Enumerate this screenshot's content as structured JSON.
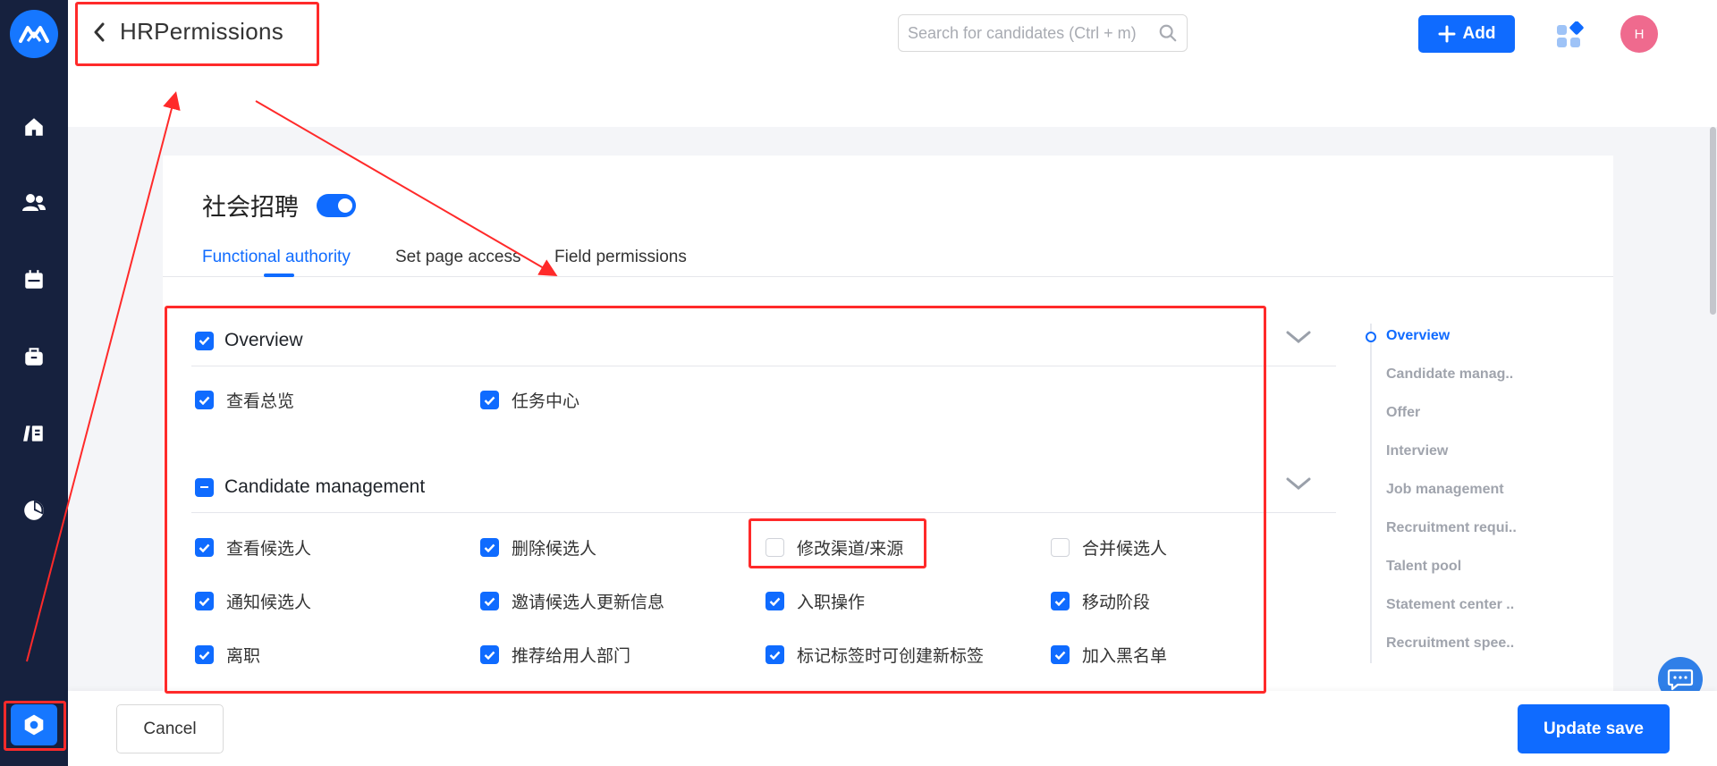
{
  "page": {
    "title": "HRPermissions",
    "back_icon": "chevron-left-icon"
  },
  "topbar": {
    "search_placeholder": "Search for candidates (Ctrl + m)",
    "add_label": "Add",
    "avatar_initial": "H"
  },
  "sidebar": {
    "items": [
      "home-icon",
      "users-icon",
      "calendar-icon",
      "briefcase-icon",
      "book-icon",
      "pie-chart-icon",
      "settings-icon"
    ],
    "active": "settings-icon"
  },
  "recruitment": {
    "title": "社会招聘",
    "enabled": true
  },
  "tabs": [
    {
      "label": "Functional authority",
      "active": true
    },
    {
      "label": "Set page access",
      "active": false
    },
    {
      "label": "Field permissions",
      "active": false
    }
  ],
  "sections": {
    "overview": {
      "title": "Overview",
      "state": "checked",
      "items": [
        {
          "label": "查看总览",
          "checked": true
        },
        {
          "label": "任务中心",
          "checked": true
        }
      ]
    },
    "candidate_management": {
      "title": "Candidate management",
      "state": "indeterminate",
      "items": [
        {
          "label": "查看候选人",
          "checked": true
        },
        {
          "label": "删除候选人",
          "checked": true
        },
        {
          "label": "修改渠道/来源",
          "checked": false
        },
        {
          "label": "合并候选人",
          "checked": false
        },
        {
          "label": "通知候选人",
          "checked": true
        },
        {
          "label": "邀请候选人更新信息",
          "checked": true
        },
        {
          "label": "入职操作",
          "checked": true
        },
        {
          "label": "移动阶段",
          "checked": true
        },
        {
          "label": "离职",
          "checked": true
        },
        {
          "label": "推荐给用人部门",
          "checked": true
        },
        {
          "label": "标记标签时可创建新标签",
          "checked": true
        },
        {
          "label": "加入黑名单",
          "checked": true
        }
      ]
    }
  },
  "right_nav": [
    {
      "label": "Overview",
      "active": true
    },
    {
      "label": "Candidate manag..",
      "active": false
    },
    {
      "label": "Offer",
      "active": false
    },
    {
      "label": "Interview",
      "active": false
    },
    {
      "label": "Job management",
      "active": false
    },
    {
      "label": "Recruitment requi..",
      "active": false
    },
    {
      "label": "Talent pool",
      "active": false
    },
    {
      "label": "Statement center ..",
      "active": false
    },
    {
      "label": "Recruitment spee..",
      "active": false
    }
  ],
  "footer": {
    "cancel_label": "Cancel",
    "save_label": "Update save"
  },
  "colors": {
    "primary": "#0f6bff",
    "sidebar": "#16213e",
    "annotation": "#ff2a2a",
    "avatar": "#ef6a8e"
  }
}
